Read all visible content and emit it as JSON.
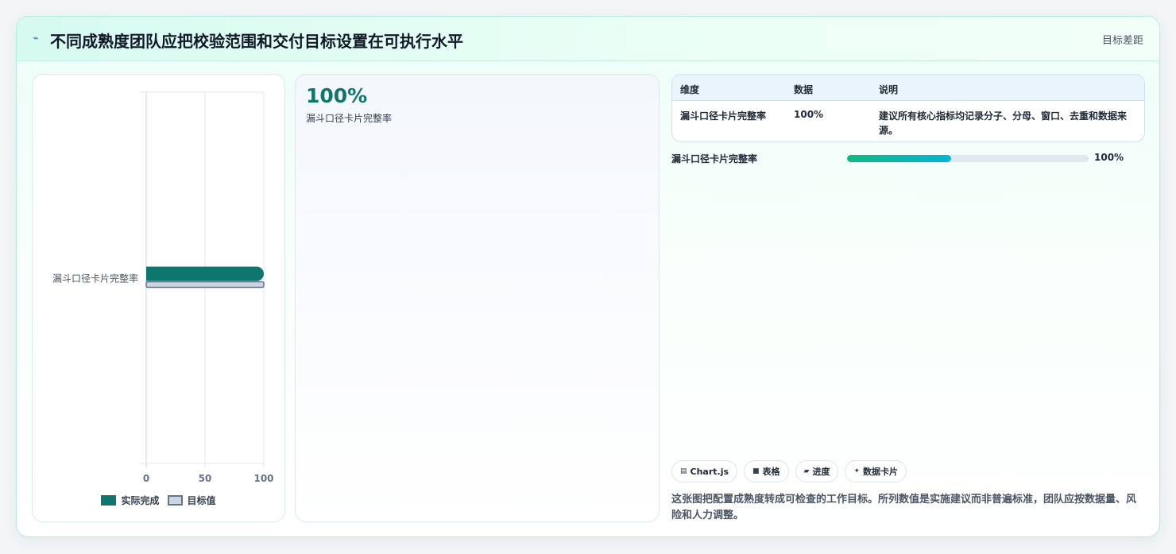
{
  "header": {
    "icon": "sparkle-icon",
    "title": "不同成熟度团队应把校验范围和交付目标设置在可执行水平",
    "tag": "目标差距"
  },
  "chart_data": {
    "type": "bar",
    "orientation": "horizontal",
    "categories": [
      "漏斗口径卡片完整率"
    ],
    "series": [
      {
        "name": "实际完成",
        "values": [
          100
        ],
        "color": "#0f766e"
      },
      {
        "name": "目标值",
        "values": [
          100
        ],
        "color": "#cbd5e1"
      }
    ],
    "xlim": [
      0,
      100
    ],
    "xticks": [
      0,
      50,
      100
    ],
    "grid": true,
    "legend": "bottom"
  },
  "stat": {
    "value": "100%",
    "label": "漏斗口径卡片完整率"
  },
  "table": {
    "headers": [
      "维度",
      "数据",
      "说明"
    ],
    "rows": [
      [
        "漏斗口径卡片完整率",
        "100%",
        "建议所有核心指标均记录分子、分母、窗口、去重和数据来源。"
      ]
    ]
  },
  "progress": {
    "label": "漏斗口径卡片完整率",
    "value_text": "100%",
    "fill_fraction": 0.43
  },
  "chips": [
    {
      "icon": "chart-icon",
      "glyph": "▤",
      "label": "Chart.js"
    },
    {
      "icon": "table-icon",
      "glyph": "■",
      "label": "表格"
    },
    {
      "icon": "progress-icon",
      "glyph": "▰",
      "label": "进度"
    },
    {
      "icon": "star-icon",
      "glyph": "✦",
      "label": "数据卡片"
    }
  ],
  "note": "这张图把配置成熟度转成可检查的工作目标。所列数值是实施建议而非普遍标准，团队应按数据量、风险和人力调整。"
}
